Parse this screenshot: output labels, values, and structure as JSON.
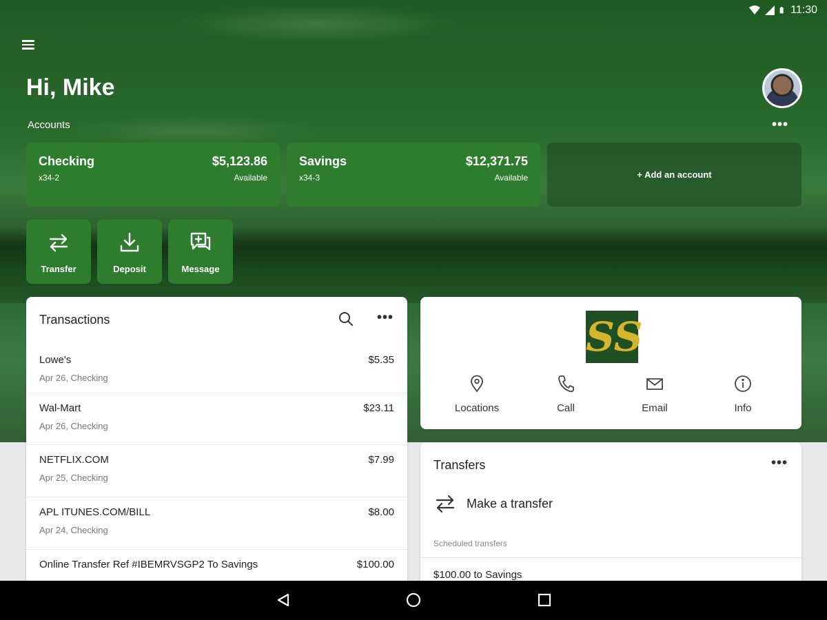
{
  "status_bar": {
    "time": "11:30"
  },
  "header": {
    "greeting": "Hi, Mike"
  },
  "accounts": {
    "label": "Accounts",
    "items": [
      {
        "name": "Checking",
        "number": "x34-2",
        "balance": "$5,123.86",
        "balance_label": "Available"
      },
      {
        "name": "Savings",
        "number": "x34-3",
        "balance": "$12,371.75",
        "balance_label": "Available"
      }
    ],
    "add_label": "+ Add an account"
  },
  "actions": [
    {
      "label": "Transfer",
      "icon": "transfer-icon"
    },
    {
      "label": "Deposit",
      "icon": "deposit-icon"
    },
    {
      "label": "Message",
      "icon": "message-icon"
    }
  ],
  "transactions": {
    "title": "Transactions",
    "items": [
      {
        "name": "Lowe's",
        "detail": "Apr 26, Checking",
        "amount": "$5.35"
      },
      {
        "name": "Wal-Mart",
        "detail": "Apr 26, Checking",
        "amount": "$23.11"
      },
      {
        "name": "NETFLIX.COM",
        "detail": "Apr 25, Checking",
        "amount": "$7.99"
      },
      {
        "name": "APL ITUNES.COM/BILL",
        "detail": "Apr 24, Checking",
        "amount": "$8.00"
      },
      {
        "name": "Online Transfer Ref #IBEMRVSGP2 To Savings",
        "detail": "",
        "amount": "$100.00"
      }
    ]
  },
  "branch": {
    "logo_text": "SS",
    "items": [
      {
        "label": "Locations",
        "icon": "location-pin-icon"
      },
      {
        "label": "Call",
        "icon": "phone-icon"
      },
      {
        "label": "Email",
        "icon": "email-icon"
      },
      {
        "label": "Info",
        "icon": "info-icon"
      }
    ]
  },
  "transfers": {
    "title": "Transfers",
    "make_label": "Make a transfer",
    "scheduled_label": "Scheduled transfers",
    "scheduled_items": [
      "$100.00 to Savings"
    ]
  },
  "colors": {
    "accent": "#2e7d2e",
    "hero_bg": "#1f5a22"
  }
}
